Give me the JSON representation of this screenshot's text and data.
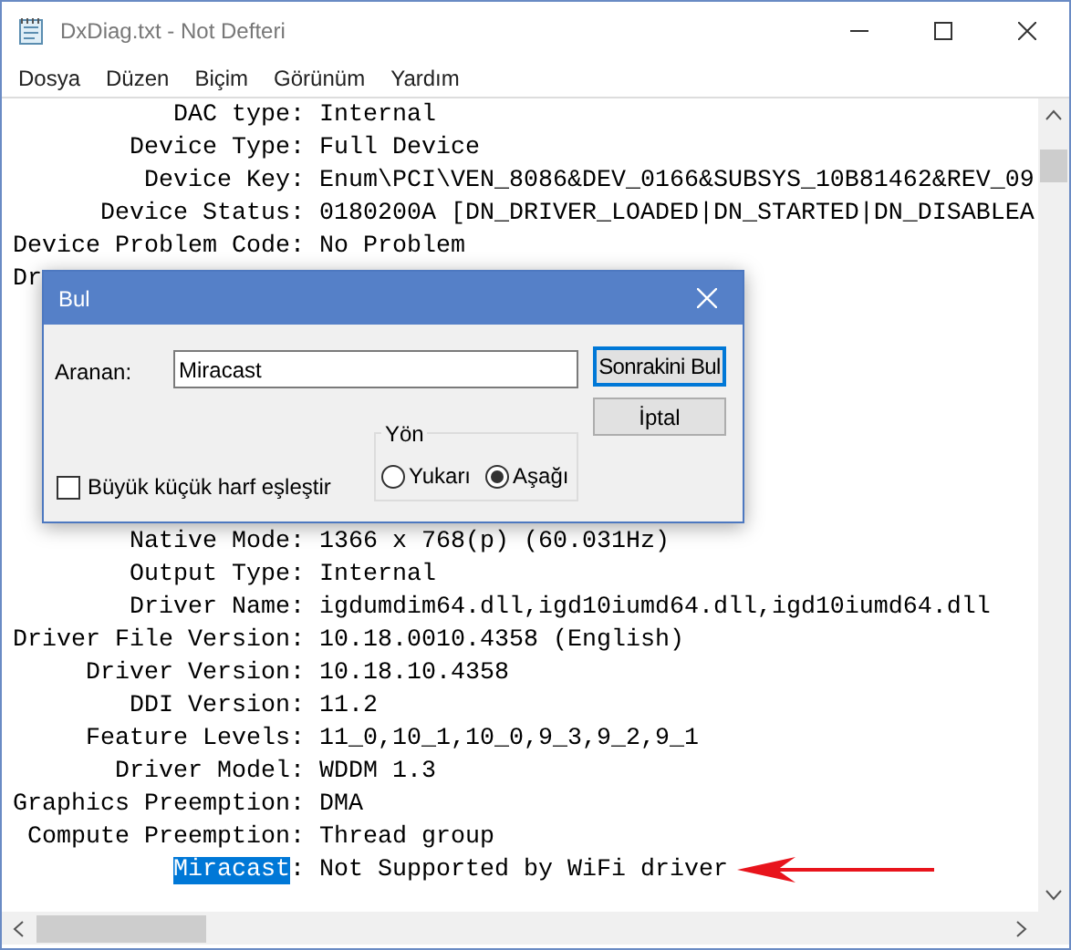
{
  "window": {
    "title": "DxDiag.txt - Not Defteri"
  },
  "menu": [
    "Dosya",
    "Düzen",
    "Biçim",
    "Görünüm",
    "Yardım"
  ],
  "text_top": [
    {
      "key": "DAC type",
      "sep": ":",
      "value": "Internal",
      "key_selected": false
    },
    {
      "key": "Device Type",
      "sep": ":",
      "value": "Full Device",
      "key_selected": false
    },
    {
      "key": "Device Key",
      "sep": ":",
      "value": "Enum\\PCI\\VEN_8086&DEV_0166&SUBSYS_10B81462&REV_09",
      "key_selected": false
    },
    {
      "key": "Device Status",
      "sep": ":",
      "value": "0180200A [DN_DRIVER_LOADED|DN_STARTED|DN_DISABLEA",
      "key_selected": false
    },
    {
      "key": "Device Problem Code",
      "sep": ":",
      "value": "No Problem",
      "key_selected": false
    }
  ],
  "partial_line": "Dr",
  "text_bottom": [
    {
      "key": "Native Mode",
      "sep": ":",
      "value": "1366 x 768(p) (60.031Hz)",
      "key_selected": false
    },
    {
      "key": "Output Type",
      "sep": ":",
      "value": "Internal",
      "key_selected": false
    },
    {
      "key": "Driver Name",
      "sep": ":",
      "value": "igdumdim64.dll,igd10iumd64.dll,igd10iumd64.dll",
      "key_selected": false
    },
    {
      "key": "Driver File Version",
      "sep": ":",
      "value": "10.18.0010.4358 (English)",
      "key_selected": false
    },
    {
      "key": "Driver Version",
      "sep": ":",
      "value": "10.18.10.4358",
      "key_selected": false
    },
    {
      "key": "DDI Version",
      "sep": ":",
      "value": "11.2",
      "key_selected": false
    },
    {
      "key": "Feature Levels",
      "sep": ":",
      "value": "11_0,10_1,10_0,9_3,9_2,9_1",
      "key_selected": false
    },
    {
      "key": "Driver Model",
      "sep": ":",
      "value": "WDDM 1.3",
      "key_selected": false
    },
    {
      "key": "Graphics Preemption",
      "sep": ":",
      "value": "DMA",
      "key_selected": false
    },
    {
      "key": "Compute Preemption",
      "sep": ":",
      "value": "Thread group",
      "key_selected": false
    },
    {
      "key": "Miracast",
      "sep": ":",
      "value": "Not Supported by WiFi driver",
      "key_selected": true
    }
  ],
  "find_dialog": {
    "title": "Bul",
    "search_label": "Aranan:",
    "search_value": "Miracast",
    "find_next": "Sonrakini Bul",
    "cancel": "İptal",
    "match_case": {
      "label": "Büyük küçük harf eşleştir",
      "checked": false
    },
    "direction": {
      "title": "Yön",
      "options": [
        {
          "label": "Yukarı",
          "selected": false
        },
        {
          "label": "Aşağı",
          "selected": true
        }
      ]
    }
  }
}
